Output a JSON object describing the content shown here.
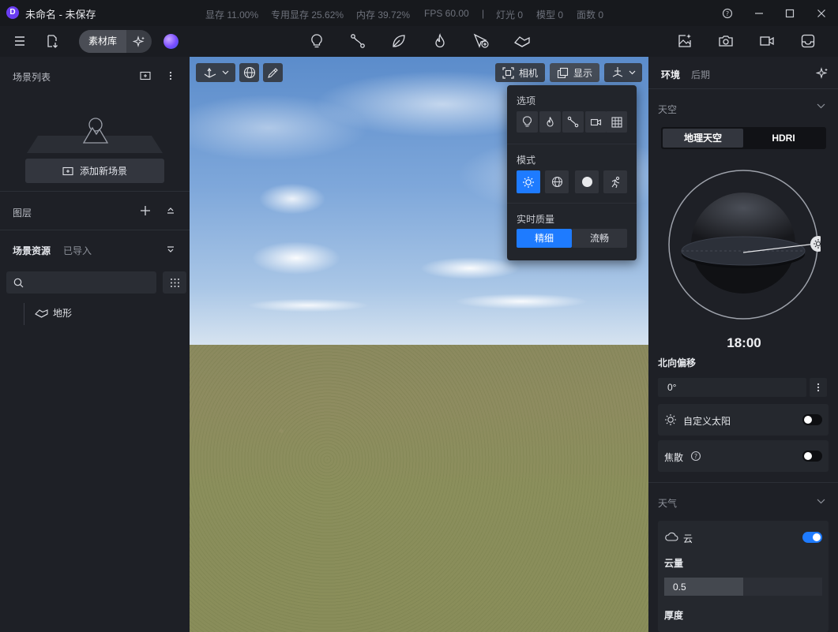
{
  "app": {
    "logo_letter": "D",
    "title": "未命名 - 未保存"
  },
  "stats": {
    "vram": "显存 11.00%",
    "dedicated_vram": "专用显存 25.62%",
    "memory": "内存 39.72%",
    "fps": "FPS 60.00",
    "separator": "|",
    "lights": "灯光 0",
    "models": "模型 0",
    "faces": "面数 0"
  },
  "toolbar": {
    "asset_library_label": "素材库",
    "center_icons": [
      "light-bulb-icon",
      "path-nodes-icon",
      "leaf-icon",
      "flame-icon",
      "add-marker-icon",
      "terrain-icon"
    ],
    "right_icons": [
      "image-sparkle-icon",
      "camera-icon",
      "video-camera-icon",
      "inbox-icon"
    ]
  },
  "left": {
    "scene_list_title": "场景列表",
    "add_scene_label": "添加新场景",
    "layers_title": "图层",
    "assets_tab_active": "场景资源",
    "assets_tab_inactive": "已导入",
    "search_placeholder": "",
    "tree": [
      {
        "label": "地形",
        "icon": "terrain-icon"
      }
    ]
  },
  "viewport": {
    "camera_label": "相机",
    "display_label": "显示"
  },
  "display_menu": {
    "options_title": "选项",
    "option_icons": [
      "light-bulb-icon",
      "flame-icon",
      "path-nodes-icon",
      "video-camera-icon",
      "grid-icon"
    ],
    "mode_title": "模式",
    "mode_icons": [
      "sun-icon",
      "globe-icon",
      "solid-circle-icon",
      "runner-icon"
    ],
    "active_mode": "sun-icon",
    "quality_title": "实时质量",
    "quality_options": [
      "精细",
      "流畅"
    ],
    "active_quality": "精细"
  },
  "right": {
    "tab_environment": "环境",
    "tab_post": "后期",
    "sky_title": "天空",
    "sky_tabs": [
      "地理天空",
      "HDRI"
    ],
    "active_sky_tab": "地理天空",
    "time": "18:00",
    "north_offset_label": "北向偏移",
    "north_offset_value": "0°",
    "custom_sun_label": "自定义太阳",
    "custom_sun_on": false,
    "caustics_label": "焦散",
    "caustics_on": false,
    "weather_title": "天气",
    "cloud_label": "云",
    "cloud_on": true,
    "cloud_amount_label": "云量",
    "cloud_amount_value": "0.5",
    "cloud_amount_fraction": 0.5,
    "thickness_label": "厚度"
  },
  "colors": {
    "accent": "#1e7bff",
    "bg": "#1e2026",
    "titlebar": "#17191d"
  }
}
